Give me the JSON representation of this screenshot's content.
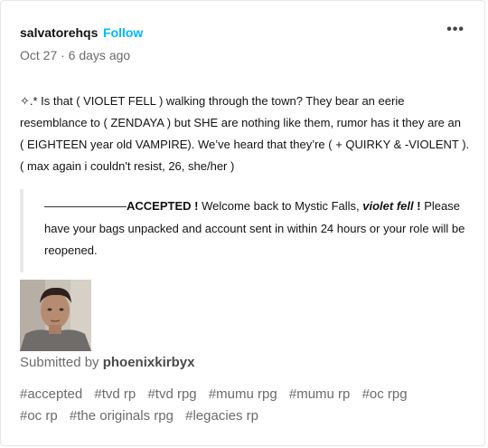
{
  "post": {
    "author": "salvatorehqs",
    "follow_label": "Follow",
    "more_label": "•••",
    "date": "Oct 27 · 6 days ago",
    "body_lines": [
      "✧.* Is that ( VIOLET FELL ) walking through the town? They bear an eerie",
      "resemblance to ( ZENDAYA ) but SHE are nothing like them, rumor has it they are an",
      "( EIGHTEEN year old VAMPIRE). We’ve heard that they’re ( + QUIRKY & -VIOLENT ).",
      "( max again i couldn't resist, 26, she/her )"
    ],
    "quote": {
      "dashes": "———————",
      "accepted": "ACCEPTED !",
      "text_a": " Welcome back to Mystic Falls, ",
      "name": "violet fell",
      "text_b": " ! ",
      "text_c": "Please have your bags unpacked and account sent in within 24 hours or your role will be reopened."
    },
    "submitted_prefix": "Submitted by ",
    "submitted_user": "phoenixkirbyx",
    "tags": [
      "#accepted",
      "#tvd rp",
      "#tvd rpg",
      "#mumu rpg",
      "#mumu rp",
      "#oc rpg",
      "#oc rp",
      "#the originals rpg",
      "#legacies rp"
    ]
  }
}
